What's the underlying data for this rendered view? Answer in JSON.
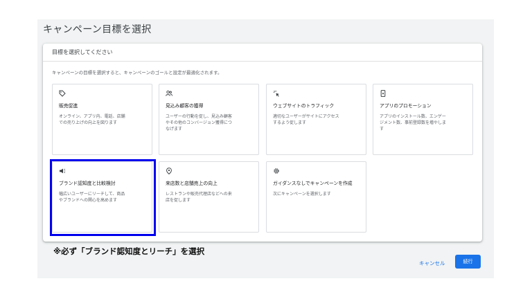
{
  "page": {
    "title": "キャンペーン目標を選択"
  },
  "card": {
    "header": "目標を選択してください",
    "description": "キャンペーンの目標を選択すると、キャンペーンのゴールと設定が最適化されます。"
  },
  "goals": [
    {
      "icon": "tag-icon",
      "title": "販売促進",
      "desc": [
        "オンライン、アプリ内、電話、店舗",
        "での売り上げの向上を図ります"
      ]
    },
    {
      "icon": "people-icon",
      "title": "見込み顧客の獲得",
      "desc": [
        "ユーザーの行動を促し、見込み顧客",
        "やその他のコンバージョン獲得につ",
        "なげます"
      ]
    },
    {
      "icon": "cursor-click-icon",
      "title": "ウェブサイトのトラフィック",
      "desc": [
        "適切なユーザーがサイトにアクセス",
        "するよう促します"
      ]
    },
    {
      "icon": "phone-icon",
      "title": "アプリのプロモーション",
      "desc": [
        "アプリのインストール数、エンゲー",
        "ジメント数、事前登録数を増やしま",
        "す"
      ]
    },
    {
      "icon": "megaphone-icon",
      "title": "ブランド認知度と比較検討",
      "desc": [
        "幅広いユーザーにリーチして、商品",
        "やブランドへの関心を高めます"
      ]
    },
    {
      "icon": "location-pin-icon",
      "title": "来店数と店舗売上の向上",
      "desc": [
        "レストランや販売代理店などへの来",
        "店を促します"
      ]
    },
    {
      "icon": "gear-icon",
      "title": "ガイダンスなしでキャンペーンを作成",
      "desc": [
        "次にキャンペーンを選択します"
      ]
    }
  ],
  "annotation": "※必ず「ブランド認知度とリーチ」を選択",
  "footer": {
    "cancel_label": "キャンセル",
    "continue_label": "続行"
  },
  "colors": {
    "accent": "#1a73e8",
    "highlight": "#0000ee",
    "panel_bg": "#f1f3f4"
  }
}
